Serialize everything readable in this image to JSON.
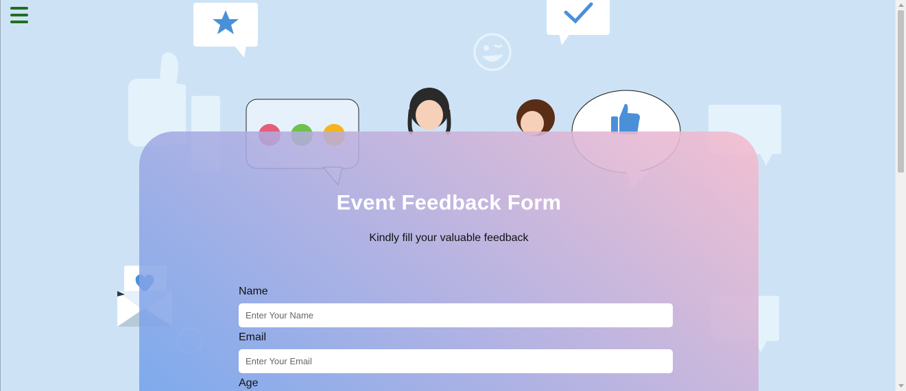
{
  "form": {
    "title": "Event Feedback Form",
    "subtitle": "Kindly fill your valuable feedback",
    "fields": [
      {
        "label": "Name",
        "placeholder": "Enter Your Name"
      },
      {
        "label": "Email",
        "placeholder": "Enter Your Email"
      },
      {
        "label": "Age"
      }
    ]
  },
  "icons": {
    "menu": "hamburger-menu-icon",
    "star": "star-icon",
    "check": "checkmark-icon",
    "smiley": "smiley-icon",
    "thumbs_up": "thumbs-up-icon",
    "heart": "heart-icon"
  },
  "colors": {
    "background": "#cde3f5",
    "menu_icon": "#1f6e1f",
    "accent_icon": "#4a90d9",
    "title": "#ffffff",
    "gradient_start": "#6ea0ec",
    "gradient_end": "#f6bcce"
  }
}
